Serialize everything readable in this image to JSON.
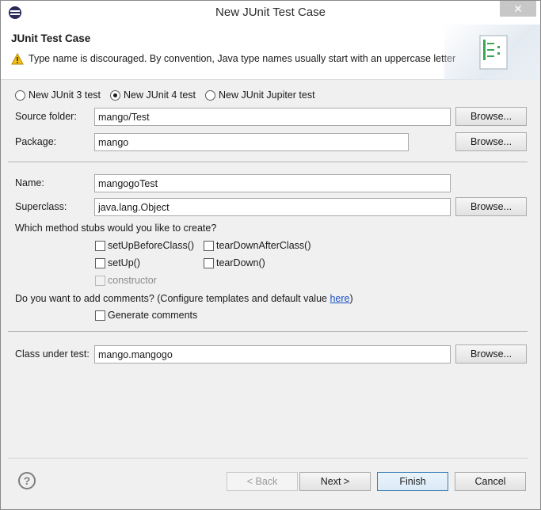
{
  "window": {
    "title": "New JUnit Test Case",
    "close_label": "✕"
  },
  "banner": {
    "title": "JUnit Test Case",
    "warning": "Type name is discouraged. By convention, Java type names usually start with an uppercase letter"
  },
  "junit_versions": [
    {
      "label": "New JUnit 3 test",
      "checked": false
    },
    {
      "label": "New JUnit 4 test",
      "checked": true
    },
    {
      "label": "New JUnit Jupiter test",
      "checked": false
    }
  ],
  "form": {
    "source_folder_label": "Source folder:",
    "source_folder_value": "mango/Test",
    "package_label": "Package:",
    "package_value": "mango",
    "name_label": "Name:",
    "name_value": "mangogoTest",
    "superclass_label": "Superclass:",
    "superclass_value": "java.lang.Object",
    "browse_label": "Browse...",
    "stubs_question": "Which method stubs would you like to create?",
    "stubs": {
      "setUpBeforeClass": "setUpBeforeClass()",
      "tearDownAfterClass": "tearDownAfterClass()",
      "setUp": "setUp()",
      "tearDown": "tearDown()",
      "constructor": "constructor"
    },
    "comments_question_prefix": "Do you want to add comments? (Configure templates and default value ",
    "comments_link": "here",
    "comments_question_suffix": ")",
    "generate_comments": "Generate comments",
    "class_under_test_label": "Class under test:",
    "class_under_test_value": "mango.mangogo"
  },
  "footer": {
    "help_icon": "?",
    "back": "< Back",
    "next": "Next >",
    "finish": "Finish",
    "cancel": "Cancel"
  }
}
